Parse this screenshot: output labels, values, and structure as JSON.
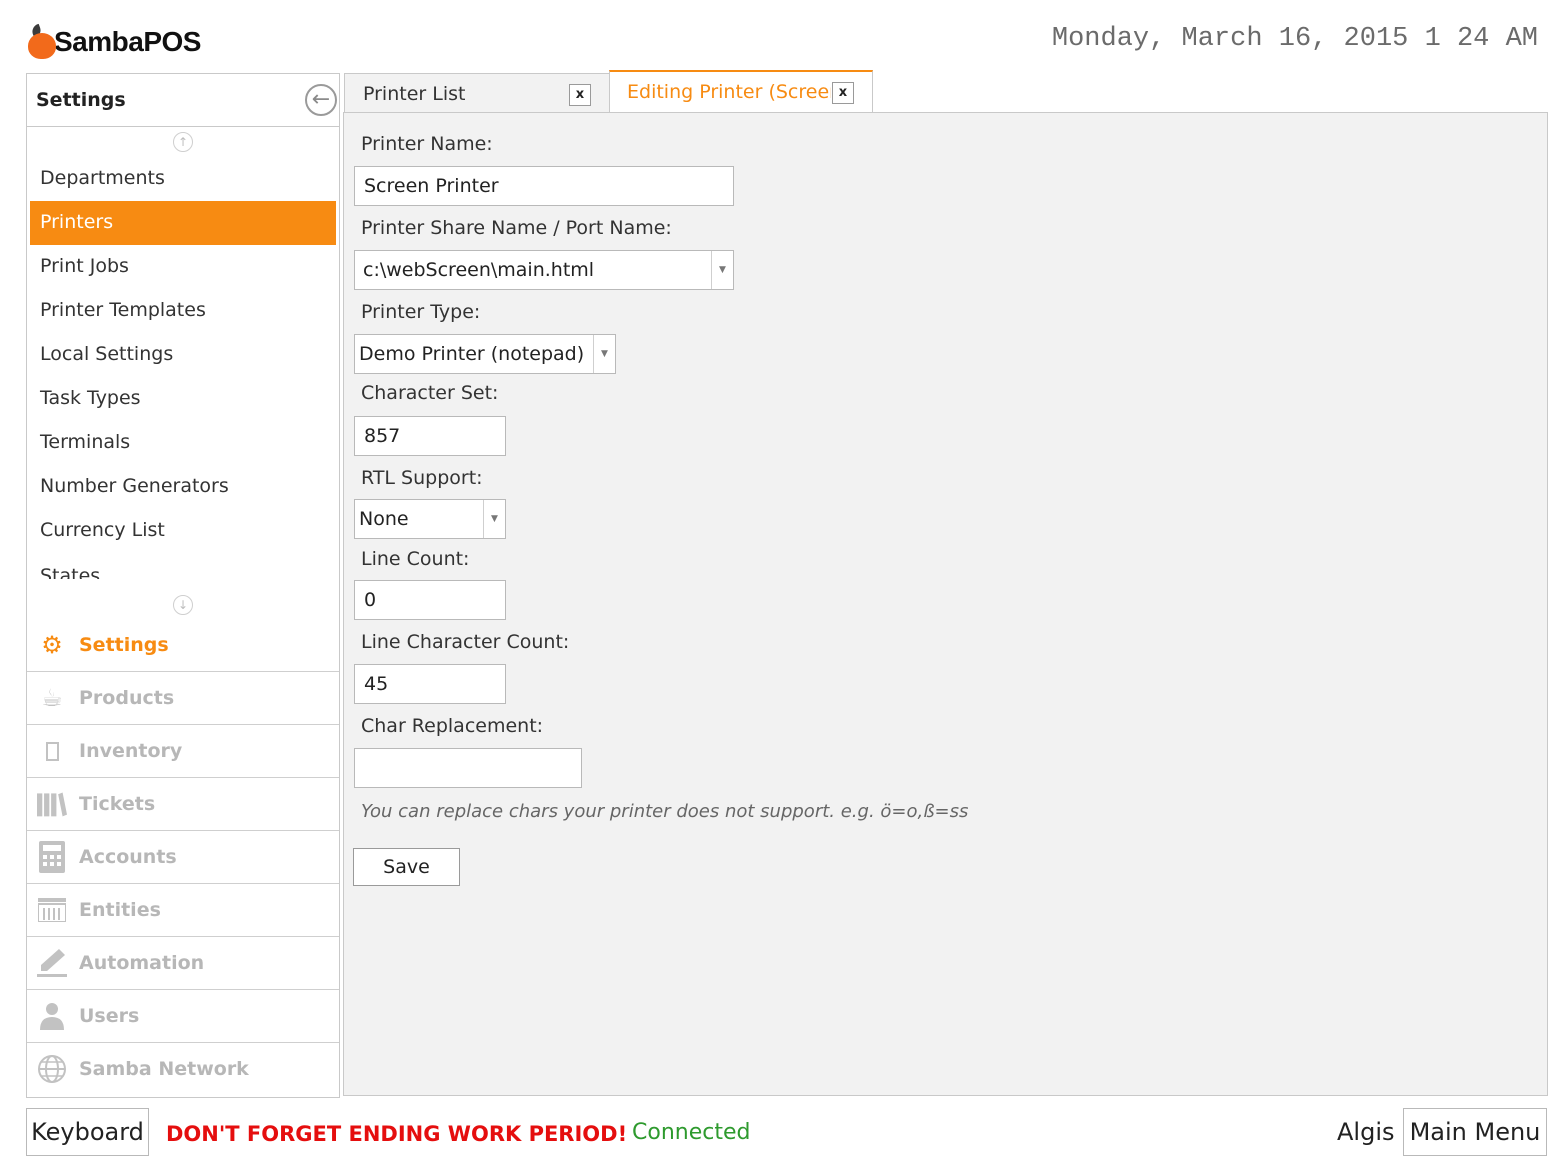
{
  "app": {
    "name": "SambaPOS",
    "datetime": "Monday, March 16, 2015 1 24 AM"
  },
  "sidebar": {
    "title": "Settings",
    "items": [
      {
        "label": "Departments"
      },
      {
        "label": "Printers",
        "active": true
      },
      {
        "label": "Print Jobs"
      },
      {
        "label": "Printer Templates"
      },
      {
        "label": "Local Settings"
      },
      {
        "label": "Task Types"
      },
      {
        "label": "Terminals"
      },
      {
        "label": "Number Generators"
      },
      {
        "label": "Currency List"
      },
      {
        "label": "States"
      }
    ],
    "modules": [
      {
        "label": "Settings",
        "icon": "gear-icon",
        "active": true
      },
      {
        "label": "Products",
        "icon": "coffee-cup-icon"
      },
      {
        "label": "Inventory",
        "icon": "box-icon"
      },
      {
        "label": "Tickets",
        "icon": "books-icon"
      },
      {
        "label": "Accounts",
        "icon": "calculator-icon"
      },
      {
        "label": "Entities",
        "icon": "table-icon"
      },
      {
        "label": "Automation",
        "icon": "pencil-icon"
      },
      {
        "label": "Users",
        "icon": "user-icon"
      },
      {
        "label": "Samba Network",
        "icon": "globe-icon"
      }
    ]
  },
  "tabs": [
    {
      "label": "Printer List",
      "close": "x"
    },
    {
      "label": "Editing Printer (Screen Printer)",
      "close": "x",
      "active": true
    }
  ],
  "form": {
    "printer_name_label": "Printer Name:",
    "printer_name": "Screen Printer",
    "share_name_label": "Printer Share Name / Port Name:",
    "share_name": "c:\\webScreen\\main.html",
    "printer_type_label": "Printer Type:",
    "printer_type": "Demo Printer (notepad)",
    "charset_label": "Character Set:",
    "charset": "857",
    "rtl_label": "RTL Support:",
    "rtl": "None",
    "line_count_label": "Line Count:",
    "line_count": "0",
    "line_char_count_label": "Line Character Count:",
    "line_char_count": "45",
    "char_replacement_label": "Char Replacement:",
    "char_replacement": "",
    "hint": "You can replace chars your printer does not support. e.g. ö=o,ß=ss",
    "save_label": "Save"
  },
  "footer": {
    "keyboard_label": "Keyboard",
    "warning": "DON'T FORGET ENDING WORK PERIOD!",
    "status": "Connected",
    "user": "Algis",
    "main_menu_label": "Main Menu"
  },
  "colors": {
    "accent": "#f78b12",
    "warning": "#e50e0e",
    "connected": "#2e9a2e"
  }
}
